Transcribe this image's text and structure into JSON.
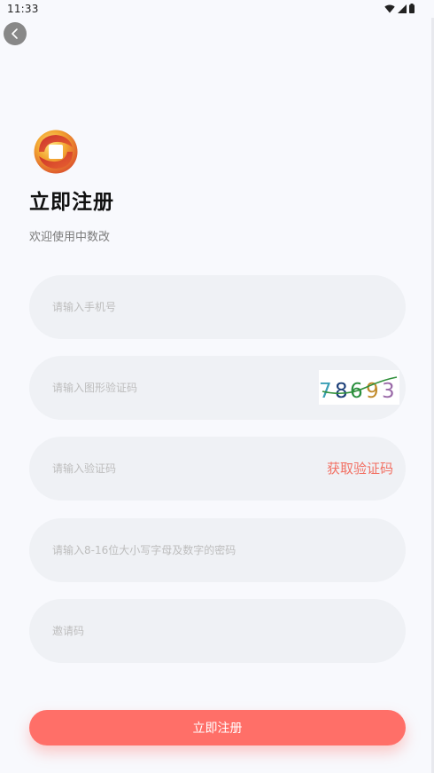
{
  "status_bar": {
    "time": "11:33"
  },
  "header": {
    "title": "立即注册",
    "subtitle": "欢迎使用中数改"
  },
  "form": {
    "phone_placeholder": "请输入手机号",
    "captcha_placeholder": "请输入图形验证码",
    "captcha_image_text": "78693",
    "code_placeholder": "请输入验证码",
    "get_code_label": "获取验证码",
    "password_placeholder": "请输入8-16位大小写字母及数字的密码",
    "invite_placeholder": "邀请码"
  },
  "submit_label": "立即注册",
  "colors": {
    "accent": "#ff6f68",
    "link": "#f27063",
    "field_bg": "#eff1f5"
  }
}
